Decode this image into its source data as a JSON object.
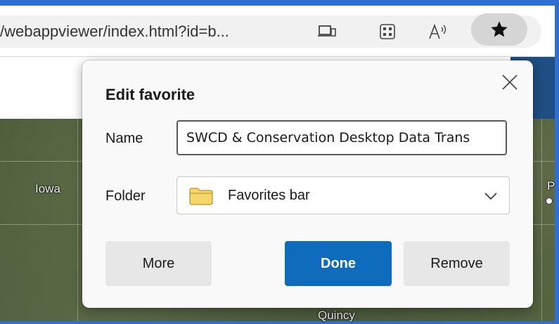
{
  "browser": {
    "url_text": "/webappviewer/index.html?id=b...",
    "icons": [
      "device-icon",
      "apps-icon",
      "read-aloud-icon",
      "favorite-star-icon"
    ]
  },
  "map": {
    "labels": [
      "Iowa",
      "Quincy"
    ],
    "edge_label": "P"
  },
  "dialog": {
    "title": "Edit favorite",
    "name_label": "Name",
    "name_value": "SWCD & Conservation Desktop Data Trans",
    "folder_label": "Folder",
    "folder_value": "Favorites bar",
    "buttons": {
      "more": "More",
      "done": "Done",
      "remove": "Remove"
    }
  },
  "colors": {
    "accent": "#0f6cbd",
    "frame": "#2f6fd1",
    "header_blue": "#1f4e84",
    "folder_icon": "#f6d56b"
  }
}
